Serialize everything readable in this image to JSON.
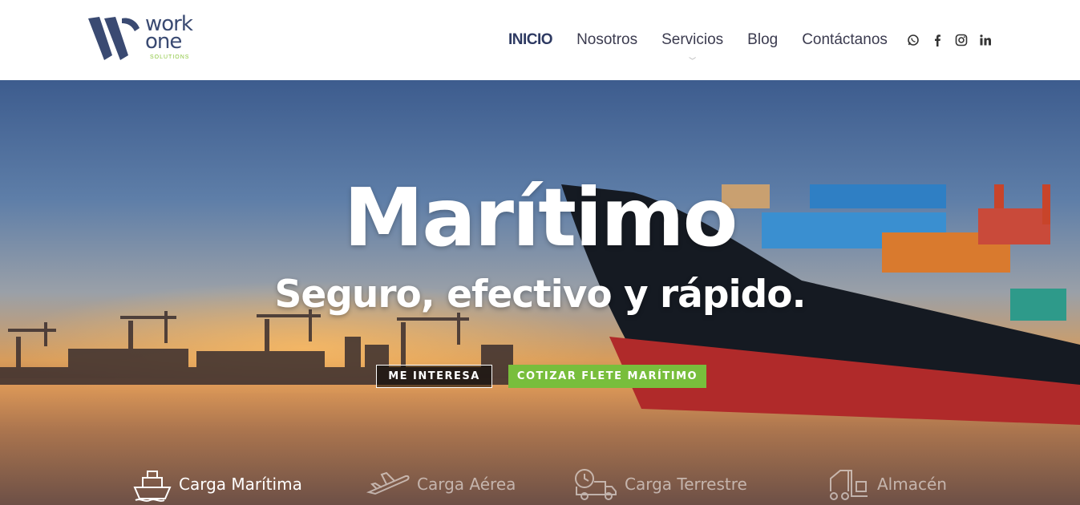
{
  "brand": {
    "line1": "work",
    "line2": "one",
    "tagline": "SOLUTIONS",
    "primary_color": "#3a4a72",
    "accent_color": "#8cc63f"
  },
  "nav": {
    "items": [
      {
        "label": "INICIO",
        "active": true
      },
      {
        "label": "Nosotros"
      },
      {
        "label": "Servicios",
        "has_dropdown": true
      },
      {
        "label": "Blog"
      },
      {
        "label": "Contáctanos"
      }
    ],
    "social": [
      "whatsapp-icon",
      "facebook-icon",
      "instagram-icon",
      "linkedin-icon"
    ]
  },
  "hero": {
    "title": "Marítimo",
    "subtitle": "Seguro, efectivo y rápido.",
    "buttons": {
      "interest": "ME INTERESA",
      "quote": "COTIZAR FLETE MARÍTIMO"
    },
    "button_green": "#78be3c"
  },
  "services": {
    "tabs": [
      {
        "label": "Carga Marítima",
        "icon": "ship-icon",
        "active": true
      },
      {
        "label": "Carga Aérea",
        "icon": "plane-icon"
      },
      {
        "label": "Carga Terrestre",
        "icon": "truck-icon"
      },
      {
        "label": "Almacén",
        "icon": "forklift-icon"
      }
    ]
  }
}
